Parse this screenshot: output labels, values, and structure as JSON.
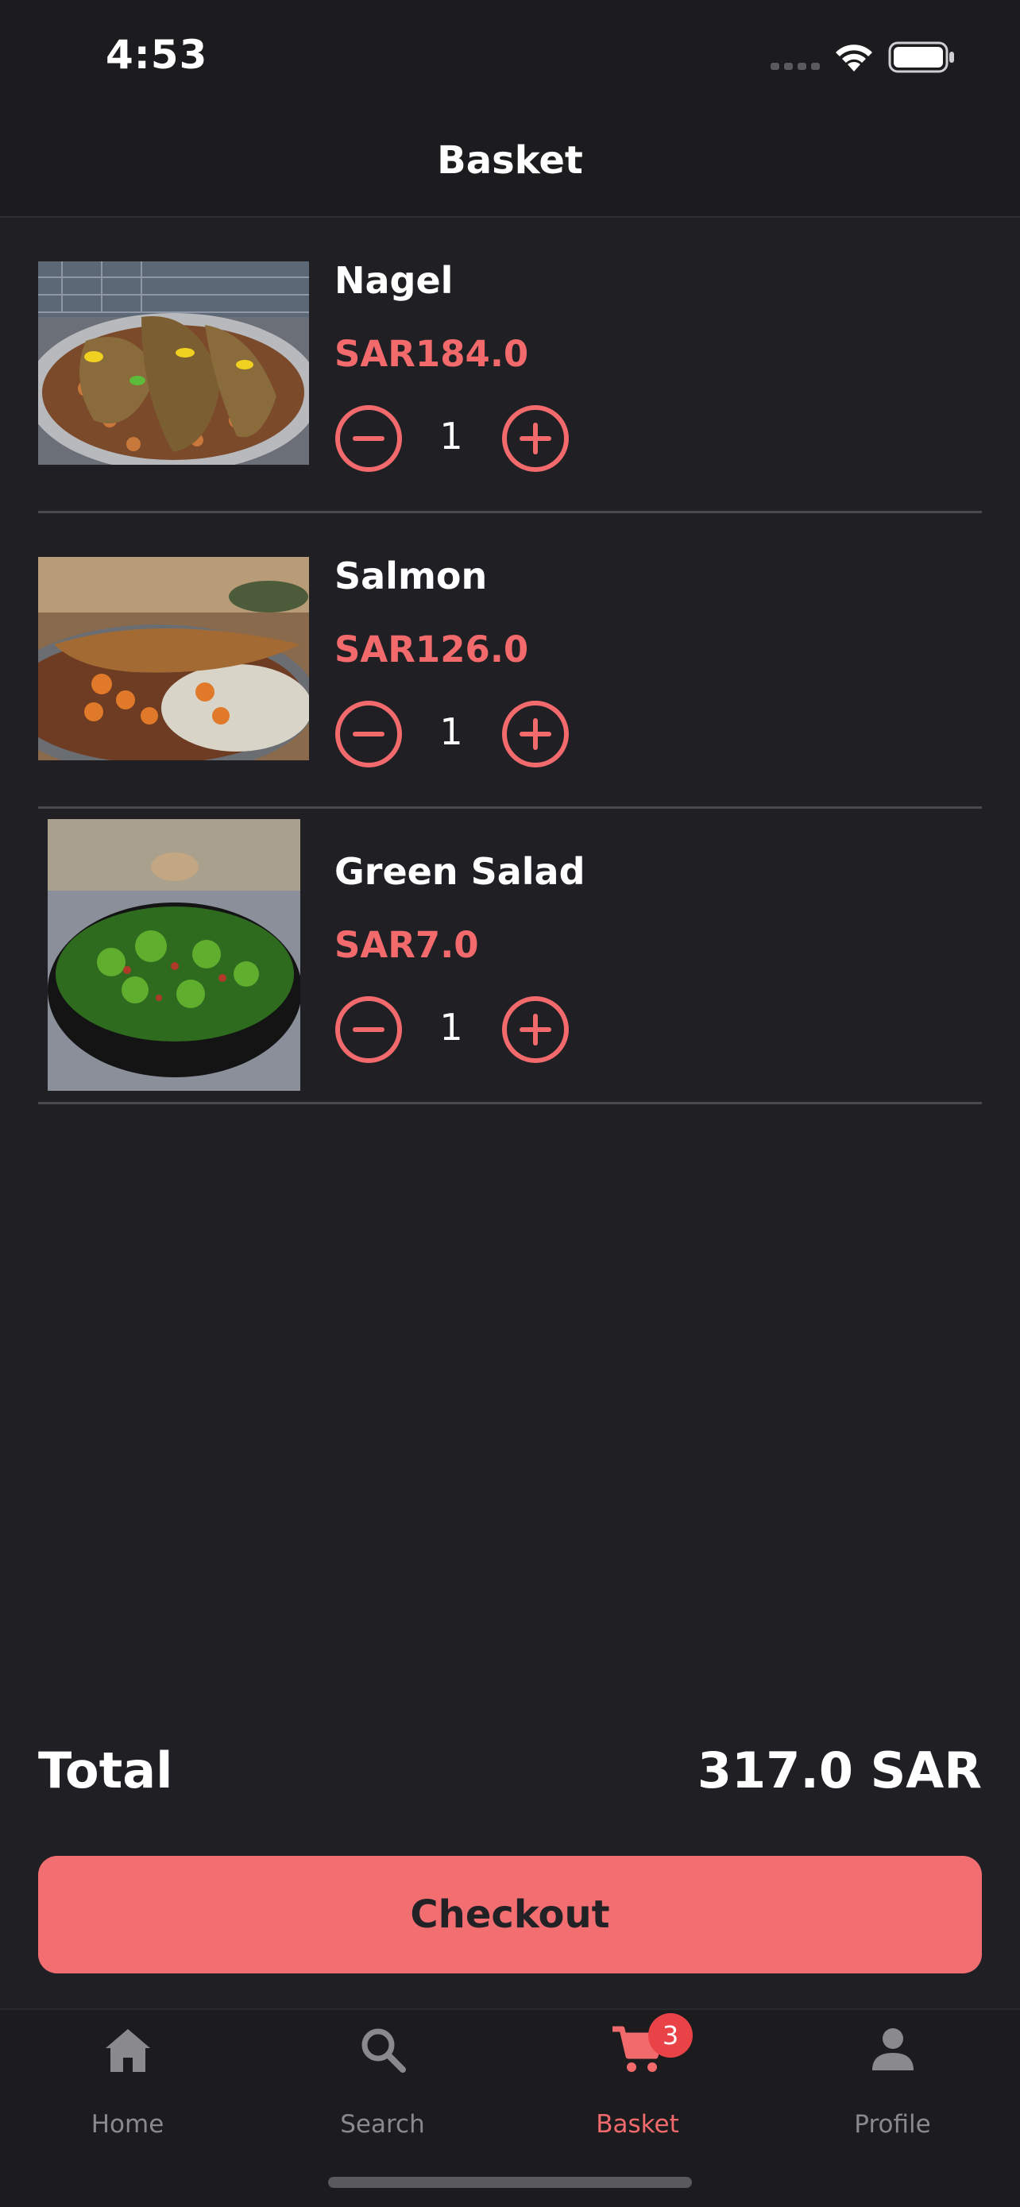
{
  "status_bar": {
    "time": "4:53"
  },
  "nav": {
    "title": "Basket"
  },
  "items": [
    {
      "name": "Nagel",
      "price": "SAR184.0",
      "quantity": "1"
    },
    {
      "name": "Salmon",
      "price": "SAR126.0",
      "quantity": "1"
    },
    {
      "name": "Green Salad",
      "price": "SAR7.0",
      "quantity": "1"
    }
  ],
  "total": {
    "label": "Total",
    "value": "317.0 SAR"
  },
  "checkout": {
    "label": "Checkout"
  },
  "tabs": [
    {
      "label": "Home",
      "icon": "house-icon"
    },
    {
      "label": "Search",
      "icon": "magnifier-icon"
    },
    {
      "label": "Basket",
      "icon": "cart-icon",
      "badge": "3"
    },
    {
      "label": "Profile",
      "icon": "person-icon"
    }
  ],
  "colors": {
    "accent": "#f36a6d",
    "background": "#202024",
    "badge": "#e94348"
  }
}
